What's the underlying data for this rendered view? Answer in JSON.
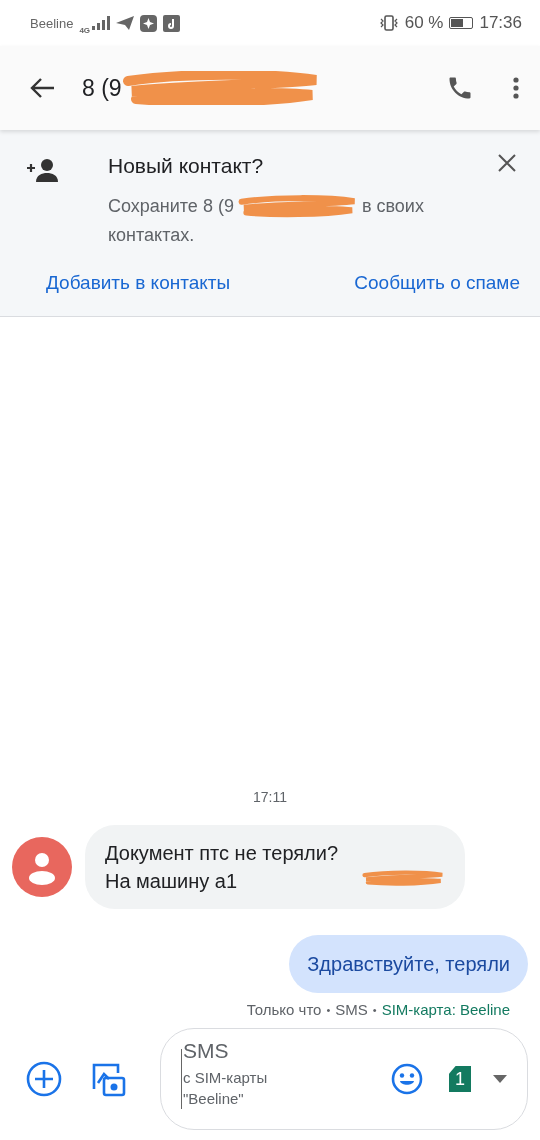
{
  "status_bar": {
    "carrier": "Beeline",
    "network": "4G",
    "battery_text": "60 %",
    "battery": {
      "level": 0.6
    },
    "time": "17:36"
  },
  "toolbar": {
    "title": "8 (9",
    "redacted": true
  },
  "banner": {
    "title": "Новый контакт?",
    "body_before": "Сохраните 8 (9",
    "redacted": true,
    "body_after": [
      "в своих",
      "контактах."
    ],
    "actions": [
      "Добавить в контакты",
      "Сообщить о спаме"
    ]
  },
  "conversation": {
    "timestamp": "17:11",
    "messages": [
      {
        "kind": "incoming",
        "text": "Документ птс не теряли? На машину а1",
        "redacted": true,
        "color": "#e8675e"
      },
      {
        "kind": "outgoing",
        "text": "Здравствуйте, теряли",
        "redacted": false
      }
    ],
    "status": {
      "time": "Только что",
      "separator_1": "•",
      "type": "SMS",
      "separator_2": "•",
      "sim": "SIM-карта: Beeline"
    }
  },
  "composer": {
    "placeholder": "SMS",
    "hint": "с SIM-карты \"Beeline\"",
    "sim_number": "1"
  }
}
